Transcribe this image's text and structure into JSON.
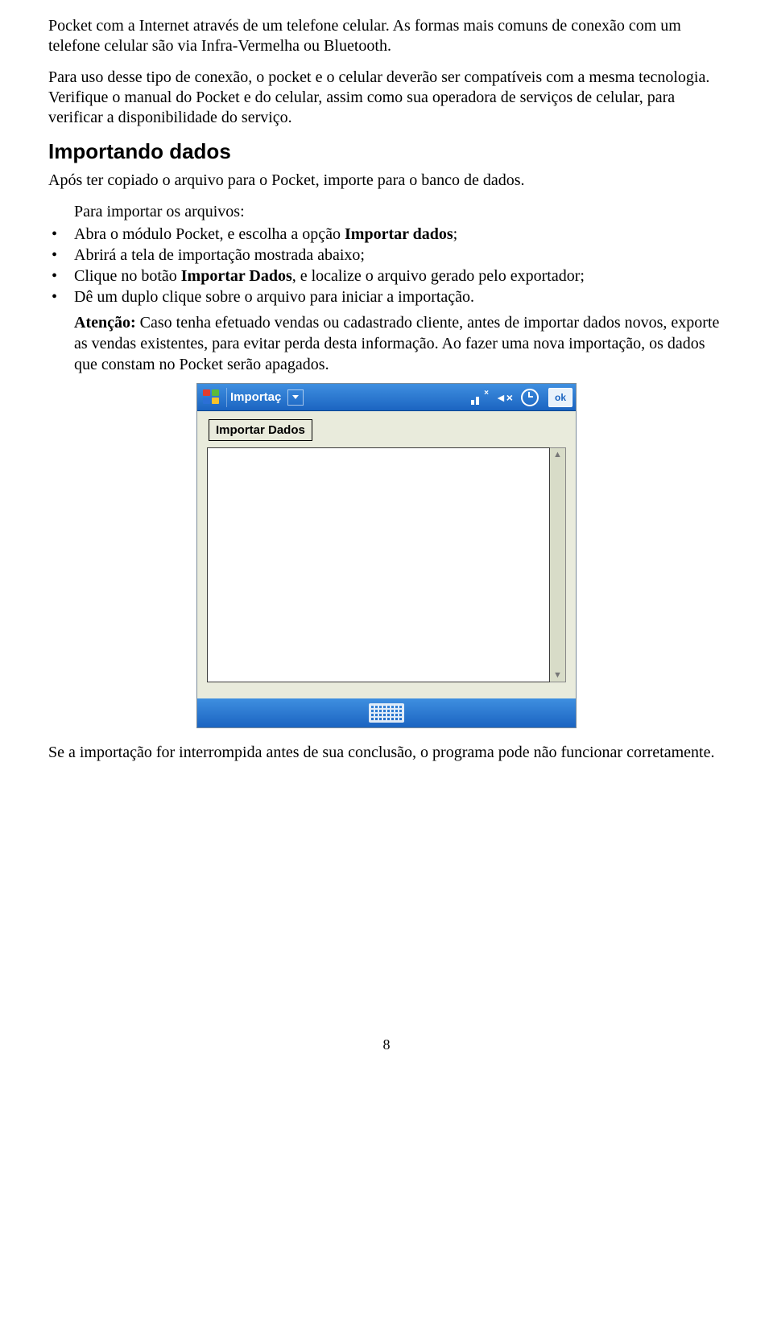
{
  "paragraphs": {
    "p1": "Pocket com a Internet através de um telefone celular. As formas mais comuns de conexão com um telefone celular são via Infra-Vermelha ou Bluetooth.",
    "p2": "Para uso desse tipo de conexão, o pocket e o celular deverão ser compatíveis com a mesma tecnologia. Verifique o manual do Pocket e do celular, assim como sua operadora de serviços de celular, para verificar a disponibilidade do serviço.",
    "heading": "Importando dados",
    "p3": "Após ter copiado o arquivo para o Pocket, importe para o banco de dados.",
    "list_intro": "Para importar os arquivos:",
    "li1_a": "Abra o módulo Pocket, e escolha a opção ",
    "li1_b": "Importar dados",
    "li1_c": ";",
    "li2": "Abrirá a tela de importação mostrada abaixo;",
    "li3_a": "Clique no botão ",
    "li3_b": "Importar Dados",
    "li3_c": ", e localize o arquivo gerado pelo exportador;",
    "li4": "Dê um duplo clique sobre o arquivo para iniciar a importação.",
    "attn_label": "Atenção:",
    "attn_text": " Caso tenha efetuado vendas ou cadastrado cliente, antes de importar dados novos, exporte as vendas existentes, para evitar perda desta informação. Ao fazer uma nova importação, os dados que constam no Pocket serão apagados.",
    "p_after": "Se a importação for interrompida antes de sua conclusão, o programa pode não funcionar corretamente."
  },
  "device": {
    "title": "Importaç",
    "ok": "ok",
    "button": "Importar Dados",
    "mute_glyph": "◄×"
  },
  "page_number": "8"
}
